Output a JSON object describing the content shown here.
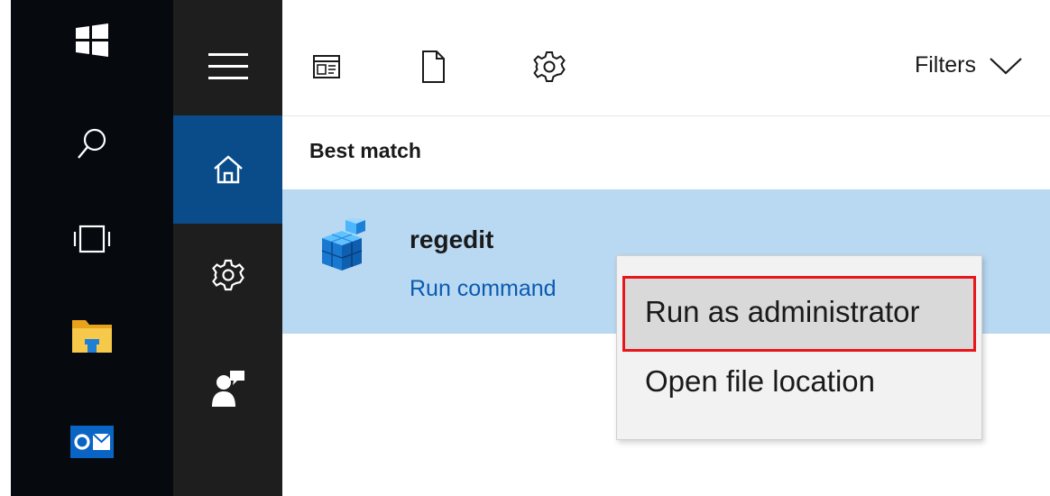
{
  "toolbar": {
    "icons": [
      "apps-icon",
      "documents-icon",
      "settings-icon"
    ],
    "filters_label": "Filters"
  },
  "taskbar": {
    "icons": [
      "windows-start-icon",
      "search-icon",
      "task-view-icon",
      "file-explorer-icon",
      "outlook-icon"
    ],
    "colors": {
      "background": "#06090d",
      "folder": "#f6c94b",
      "outlook": "#0a64c4"
    }
  },
  "start_nav": {
    "icons": [
      "hamburger-menu-icon",
      "home-icon",
      "settings-icon",
      "feedback-icon"
    ],
    "active_color": "#0a4c8a"
  },
  "results": {
    "section_title": "Best match",
    "best_match": {
      "name": "regedit",
      "type": "Run command",
      "icon": "registry-editor-icon",
      "highlight_color": "#b9d8f2"
    }
  },
  "context_menu": {
    "items": [
      {
        "label": "Run as administrator",
        "highlighted": true
      },
      {
        "label": "Open file location",
        "highlighted": false
      }
    ],
    "highlight_border_color": "#e8161b"
  }
}
